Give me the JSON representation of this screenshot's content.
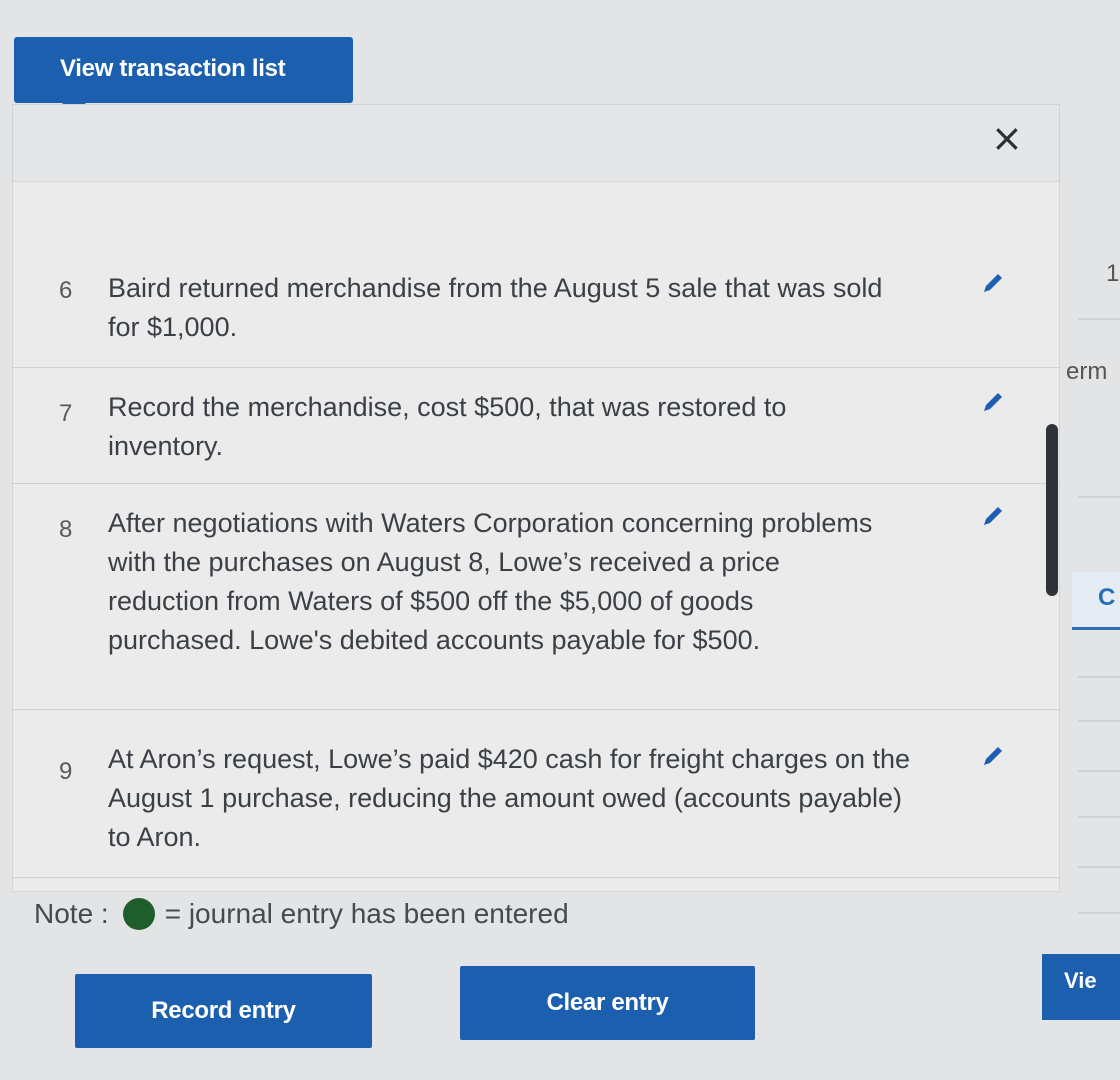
{
  "tab": {
    "label": "View transaction list"
  },
  "close_symbol": "×",
  "transactions": [
    {
      "number": "6",
      "description": "Baird returned merchandise from the August 5 sale that was sold for $1,000."
    },
    {
      "number": "7",
      "description": "Record the merchandise, cost $500, that was restored to inventory."
    },
    {
      "number": "8",
      "description": "After negotiations with Waters Corporation concerning problems with the purchases on August 8, Lowe’s received a price reduction from Waters of $500 off the $5,000 of goods purchased. Lowe's debited accounts payable for $500."
    },
    {
      "number": "9",
      "description": "At Aron’s request, Lowe’s paid $420 cash for freight charges on the August 1 purchase, reducing the amount owed (accounts payable) to Aron."
    }
  ],
  "note": {
    "label": "Note :",
    "text": "= journal entry has been entered",
    "dot_color": "#1f5d2c"
  },
  "buttons": {
    "record": "Record entry",
    "clear": "Clear entry"
  },
  "right_strip": {
    "fragment_terms": "erm",
    "fragment_c": "C",
    "fragment_view": "Vie",
    "fragment_one": "1"
  },
  "colors": {
    "accent": "#1b5fae",
    "edit_icon": "#1d5fb0"
  },
  "icons": [
    "close-icon",
    "pencil-icon",
    "green-dot-icon"
  ]
}
